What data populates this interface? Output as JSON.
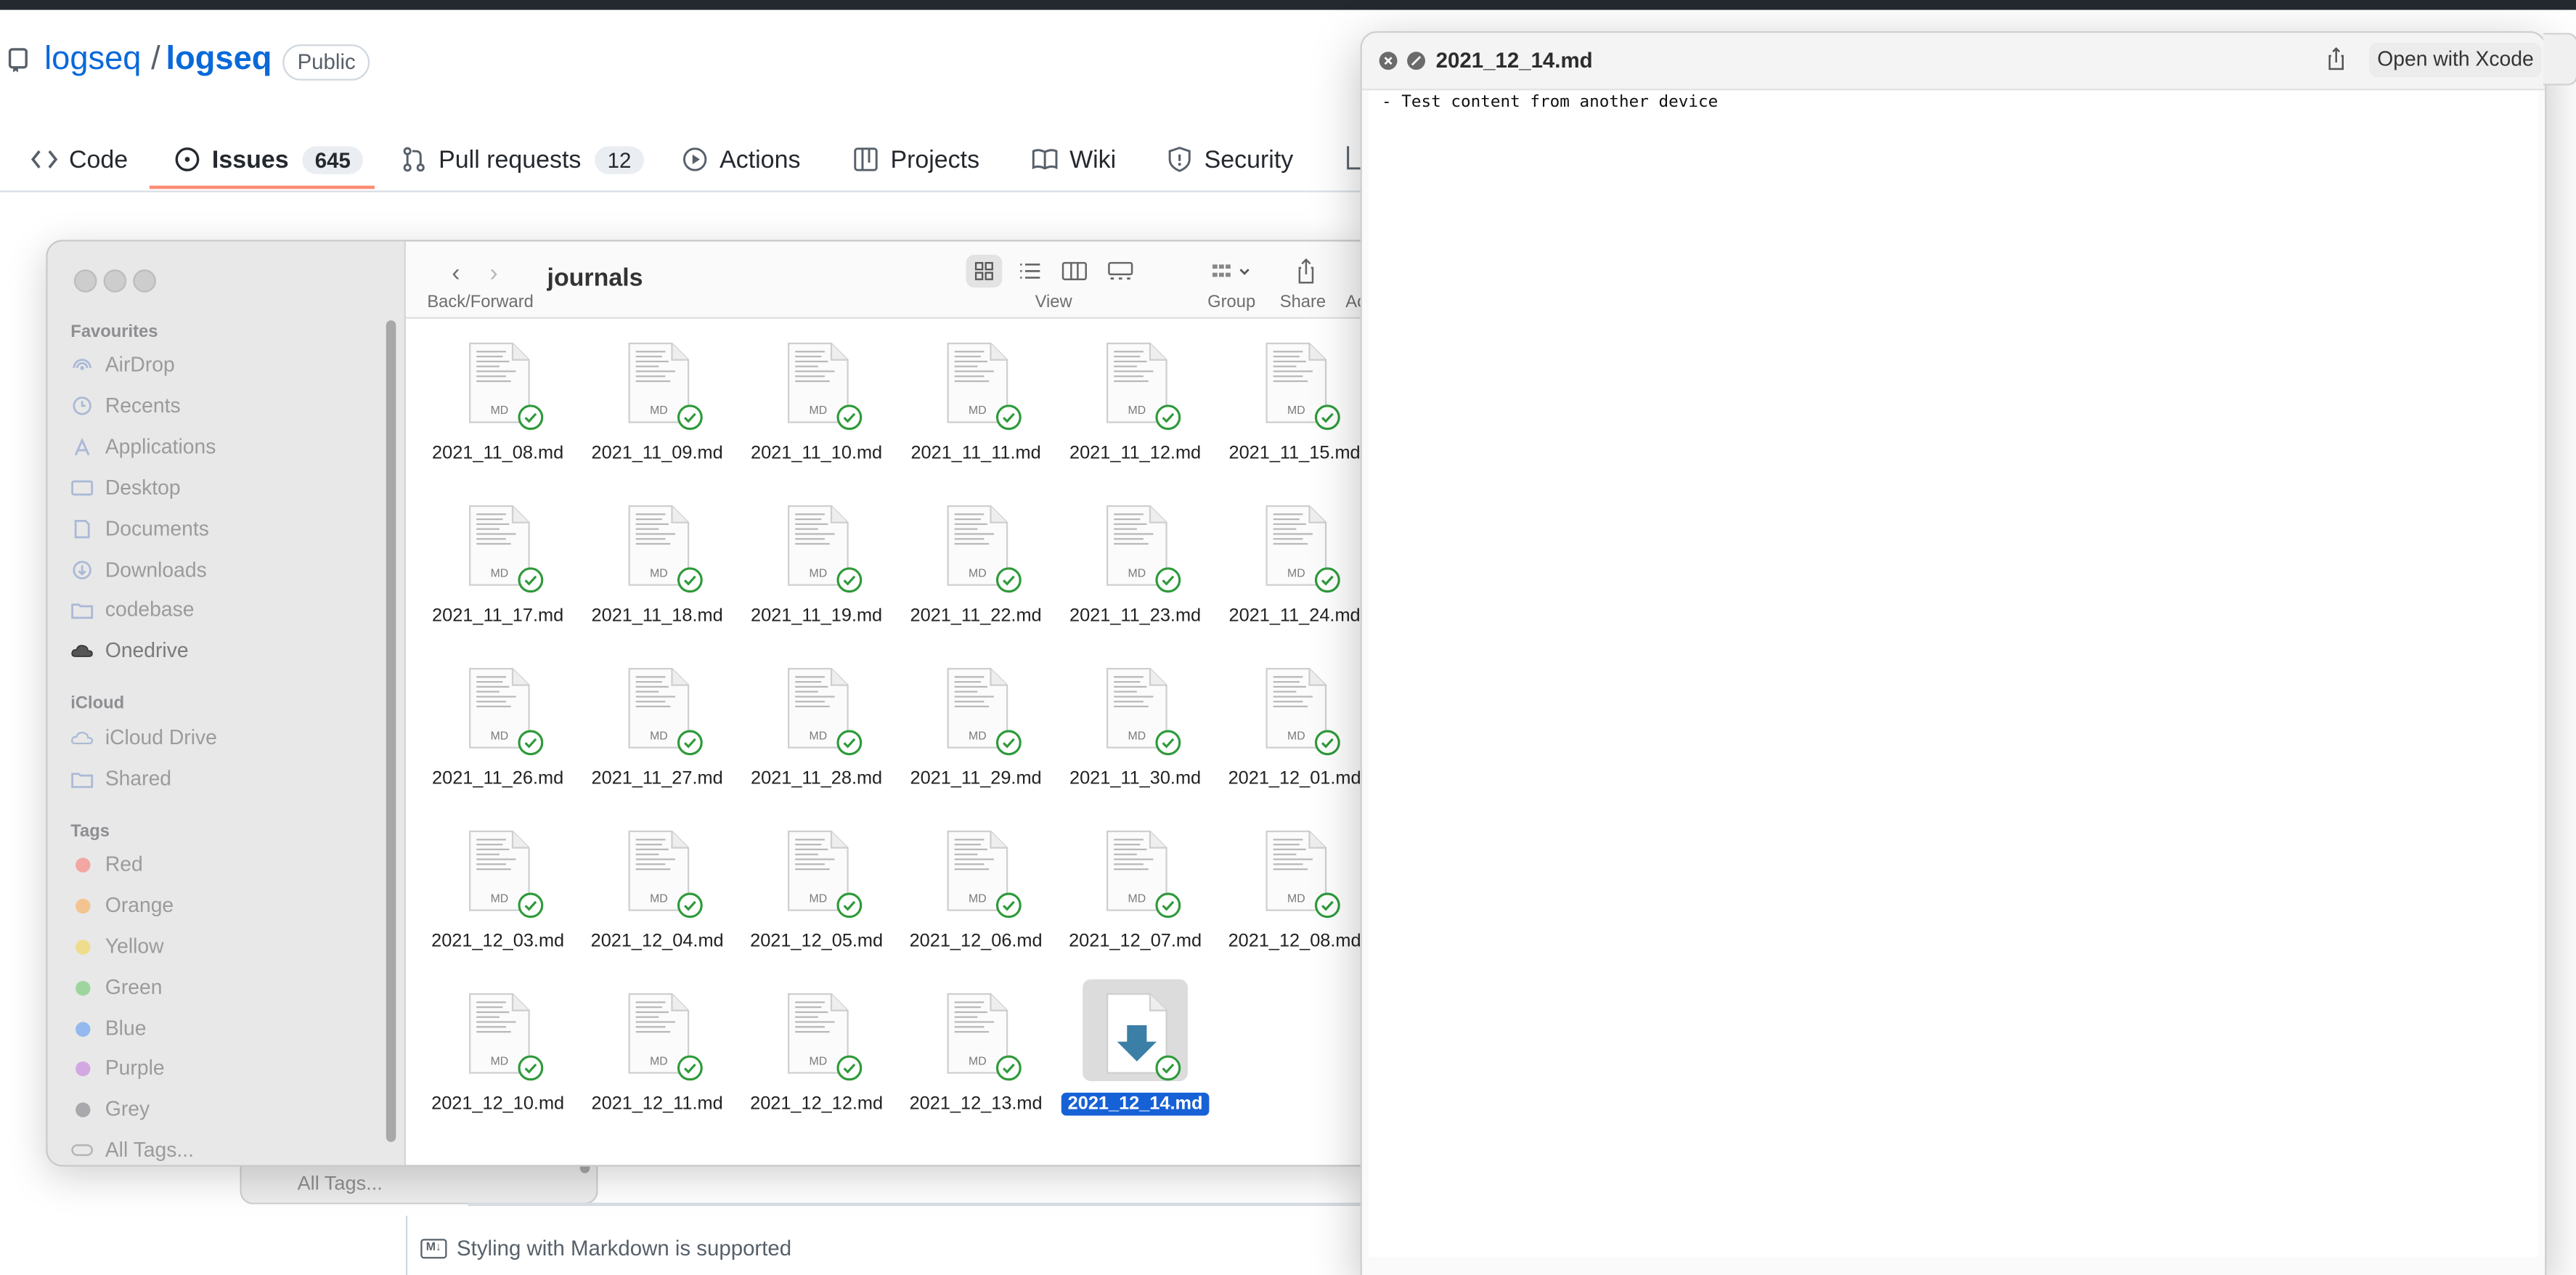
{
  "github": {
    "owner": "logseq",
    "slash": "/",
    "repo": "logseq",
    "visibility": "Public",
    "tabs": [
      {
        "label": "Code",
        "count": ""
      },
      {
        "label": "Issues",
        "count": "645"
      },
      {
        "label": "Pull requests",
        "count": "12"
      },
      {
        "label": "Actions",
        "count": ""
      },
      {
        "label": "Projects",
        "count": ""
      },
      {
        "label": "Wiki",
        "count": ""
      },
      {
        "label": "Security",
        "count": ""
      }
    ],
    "markdown_note": "Styling with Markdown is supported",
    "behind_all_tags": "All Tags..."
  },
  "finder": {
    "folder_title": "journals",
    "toolbar": {
      "back_forward_label": "Back/Forward",
      "view_label": "View",
      "group_label": "Group",
      "share_label": "Share",
      "actions_label": "Ac"
    },
    "sidebar": {
      "favourites_heading": "Favourites",
      "favourites": [
        "AirDrop",
        "Recents",
        "Applications",
        "Desktop",
        "Documents",
        "Downloads",
        "codebase",
        "Onedrive"
      ],
      "icloud_heading": "iCloud",
      "icloud": [
        "iCloud Drive",
        "Shared"
      ],
      "tags_heading": "Tags",
      "tags": [
        {
          "name": "Red",
          "color": "#f26a63"
        },
        {
          "name": "Orange",
          "color": "#f5a54a"
        },
        {
          "name": "Yellow",
          "color": "#f2cf4a"
        },
        {
          "name": "Green",
          "color": "#5bc45c"
        },
        {
          "name": "Blue",
          "color": "#3d8ef6"
        },
        {
          "name": "Purple",
          "color": "#b66fd3"
        },
        {
          "name": "Grey",
          "color": "#8e8e93"
        }
      ],
      "all_tags": "All Tags..."
    },
    "doc_badge": "MD",
    "files": [
      "2021_11_08.md",
      "2021_11_09.md",
      "2021_11_10.md",
      "2021_11_11.md",
      "2021_11_12.md",
      "2021_11_15.md",
      "2021_11_17.md",
      "2021_11_18.md",
      "2021_11_19.md",
      "2021_11_22.md",
      "2021_11_23.md",
      "2021_11_24.md",
      "2021_11_26.md",
      "2021_11_27.md",
      "2021_11_28.md",
      "2021_11_29.md",
      "2021_11_30.md",
      "2021_12_01.md",
      "2021_12_03.md",
      "2021_12_04.md",
      "2021_12_05.md",
      "2021_12_06.md",
      "2021_12_07.md",
      "2021_12_08.md",
      "2021_12_10.md",
      "2021_12_11.md",
      "2021_12_12.md",
      "2021_12_13.md",
      "2021_12_14.md"
    ],
    "selected_file": "2021_12_14.md"
  },
  "quicklook": {
    "title": "2021_12_14.md",
    "open_with": "Open with Xcode",
    "content": "- Test content from another device"
  }
}
